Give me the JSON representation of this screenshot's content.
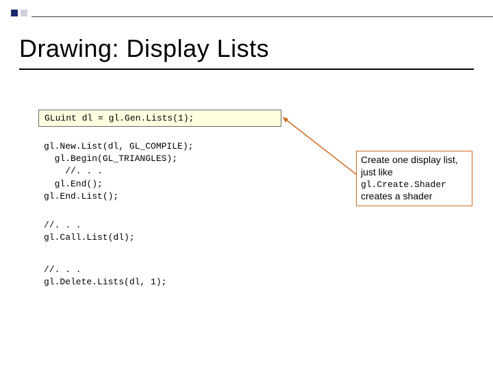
{
  "title": "Drawing:  Display Lists",
  "code_box1": "GLuint dl = gl.Gen.Lists(1);",
  "code_block2": "gl.New.List(dl, GL_COMPILE);\n  gl.Begin(GL_TRIANGLES);\n    //. . .\n  gl.End();\ngl.End.List();",
  "code_block3": "//. . .\ngl.Call.List(dl);",
  "code_block4": "//. . .\ngl.Delete.Lists(dl, 1);",
  "annotation": {
    "part1": "Create one display list, just like",
    "mono": "gl.Create.Shader",
    "part2": "creates a shader"
  }
}
